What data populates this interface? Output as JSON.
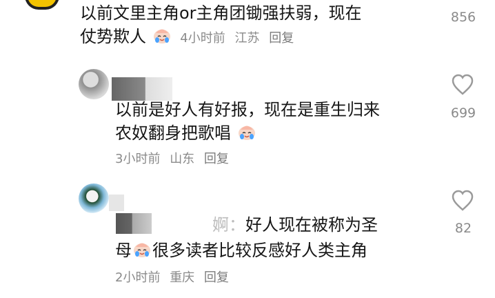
{
  "comments": [
    {
      "line1": "以前文里主角or主角团锄强扶弱，现在",
      "line2_text": "仗势欺人",
      "emoji": "crying-laughing-peach-emoji",
      "time": "4小时前",
      "location": "江苏",
      "reply": "回复",
      "likes": "856"
    },
    {
      "line1": "以前是好人有好报，现在是重生归来",
      "line2_text": "农奴翻身把歌唱",
      "emoji": "crying-laughing-peach-emoji",
      "time": "3小时前",
      "location": "山东",
      "reply": "回复",
      "likes": "699"
    },
    {
      "reply_prefix": "婀：",
      "line1": "好人现在被称为圣",
      "line2_start": "母",
      "line2_end": "很多读者比较反感好人类主角",
      "emoji": "crying-laughing-peach-emoji",
      "time": "2小时前",
      "location": "重庆",
      "reply": "回复",
      "likes": "82"
    }
  ],
  "icons": {
    "like": "heart-outline-icon"
  },
  "colors": {
    "text": "#161616",
    "meta": "#8a8a8a",
    "icon": "#9a9a9a",
    "avatar_yellow": "#f3c300"
  }
}
